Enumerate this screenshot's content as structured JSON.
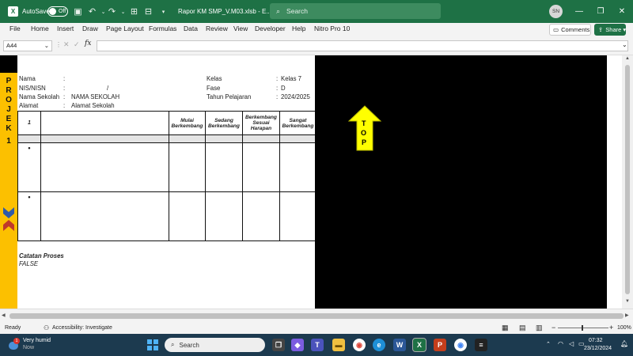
{
  "titlebar": {
    "autosave_label": "AutoSave",
    "autosave_state": "Off",
    "document_title": "Rapor KM SMP_V.M03.xlsb - E...",
    "search_placeholder": "Search",
    "user_initials": "SN",
    "accent_color": "#1e7145"
  },
  "menu": {
    "items": [
      "File",
      "Home",
      "Insert",
      "Draw",
      "Page Layout",
      "Formulas",
      "Data",
      "Review",
      "View",
      "Developer",
      "Help",
      "Nitro Pro 10"
    ],
    "comments_label": "Comments",
    "share_label": "Share"
  },
  "formula_bar": {
    "name_box": "A44",
    "fx_label": "fx",
    "formula_value": ""
  },
  "sheet": {
    "side_letters": [
      "P",
      "R",
      "O",
      "J",
      "E",
      "K",
      "1"
    ],
    "info": {
      "nama_label": "Nama",
      "nama_value": "",
      "nisn_label": "NIS/NISN",
      "nisn_value": "/",
      "sekolah_label": "Nama Sekolah",
      "sekolah_value": "NAMA SEKOLAH",
      "alamat_label": "Alamat",
      "alamat_value": "Alamat Sekolah",
      "kelas_label": "Kelas",
      "kelas_value": "Kelas 7",
      "fase_label": "Fase",
      "fase_value": "D",
      "tahun_label": "Tahun Pelajaran",
      "tahun_value": "2024/2025",
      "separator": ":"
    },
    "table": {
      "number": "1",
      "headers": [
        "Mulai Berkembang",
        "Sedang Berkembang",
        "Berkembang Sesuai Harapan",
        "Sangat Berkembang"
      ],
      "bullets": [
        "•",
        "•"
      ]
    },
    "catatan_label": "Catatan Proses",
    "catatan_value": "FALSE",
    "top_button_letters": [
      "T",
      "O",
      "P"
    ]
  },
  "status": {
    "ready": "Ready",
    "accessibility": "Accessibility: Investigate",
    "zoom": "100%"
  },
  "taskbar": {
    "weather_title": "Very humid",
    "weather_sub": "Now",
    "weather_badge": "1",
    "search_placeholder": "Search",
    "time": "07:32",
    "date": "23/12/2024"
  }
}
